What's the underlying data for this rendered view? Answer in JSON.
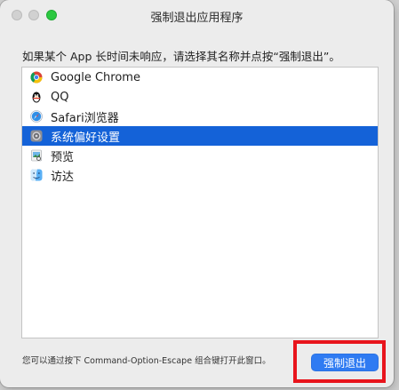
{
  "window": {
    "title": "强制退出应用程序",
    "prompt": "如果某个 App 长时间未响应，请选择其名称并点按“强制退出”。",
    "hint": "您可以通过按下 Command-Option-Escape 组合键打开此窗口。",
    "force_quit_label": "强制退出"
  },
  "apps": [
    {
      "label": "Google Chrome",
      "icon": "chrome-icon",
      "selected": false
    },
    {
      "label": "QQ",
      "icon": "qq-penguin-icon",
      "selected": false
    },
    {
      "label": "Safari浏览器",
      "icon": "safari-icon",
      "selected": false
    },
    {
      "label": "系统偏好设置",
      "icon": "system-preferences-icon",
      "selected": true
    },
    {
      "label": "预览",
      "icon": "preview-icon",
      "selected": false
    },
    {
      "label": "访达",
      "icon": "finder-icon",
      "selected": false
    }
  ],
  "colors": {
    "selection": "#1462d8",
    "button": "#2f7bf2",
    "highlight_box": "#e8141c"
  }
}
